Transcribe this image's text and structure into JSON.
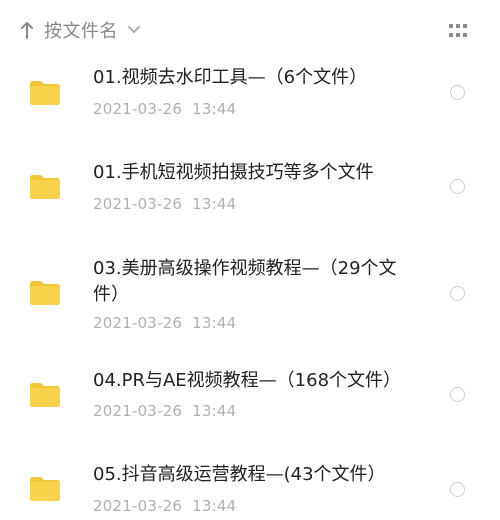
{
  "sort": {
    "label": "按文件名",
    "arrow_icon": "sort-arrow-up-icon",
    "chevron_icon": "chevron-down-icon"
  },
  "view_toggle": {
    "icon": "grid-view-icon"
  },
  "colors": {
    "folder": "#F8D24B",
    "folder_dark": "#F3C63A",
    "text_primary": "#222222",
    "text_secondary": "#B0B0B0",
    "radio_border": "#CFCFCF"
  },
  "files": [
    {
      "name": "01.视频去水印工具—（6个文件）",
      "date": "2021-03-26  13:44",
      "icon": "folder-icon",
      "selected": false
    },
    {
      "name": "01.手机短视频拍摄技巧等多个文件",
      "date": "2021-03-26  13:44",
      "icon": "folder-icon",
      "selected": false
    },
    {
      "name": "03.美册高级操作视频教程—（29个文件）",
      "date": "2021-03-26  13:44",
      "icon": "folder-icon",
      "selected": false
    },
    {
      "name": "04.PR与AE视频教程—（168个文件）",
      "date": "2021-03-26  13:44",
      "icon": "folder-icon",
      "selected": false
    },
    {
      "name": "05.抖音高级运营教程—(43个文件）",
      "date": "2021-03-26  13:44",
      "icon": "folder-icon",
      "selected": false
    }
  ]
}
